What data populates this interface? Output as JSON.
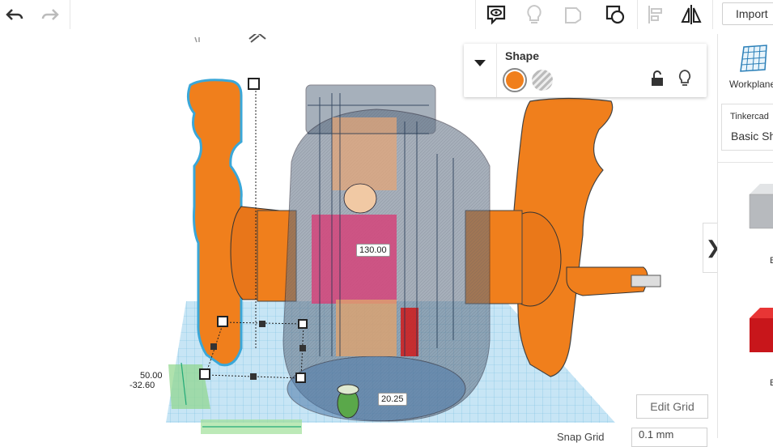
{
  "toolbar": {
    "undo_icon": "undo-arrow-icon",
    "redo_icon": "redo-arrow-icon",
    "notes_icon": "speech-bubble-eye-icon",
    "light_icon": "lightbulb-icon",
    "shape_icon": "note-shape-icon",
    "group_icon": "group-shapes-icon",
    "align_icon": "align-icon",
    "mirror_icon": "mirror-icon",
    "import_label": "Import"
  },
  "shape_panel": {
    "title": "Shape",
    "solid_color": "#f07f1c",
    "hole_label_icon": "hole-striped-icon",
    "lock_icon": "unlock-icon",
    "hide_icon": "lightbulb-icon"
  },
  "viewport": {
    "dimension_height": "130.00",
    "dimension_width": "20.25",
    "dimension_left": "50.00",
    "dimension_left2": "-32.60",
    "edit_grid_label": "Edit Grid",
    "snap_grid_label": "Snap Grid",
    "snap_grid_value": "0.1 mm"
  },
  "right_panel": {
    "workplane_label": "Workplane",
    "library_source": "Tinkercad",
    "library_name": "Basic Shapes",
    "item1_label": "B",
    "item2_label": "B"
  },
  "colors": {
    "accent": "#f07f1c",
    "selection": "#3aa7d8",
    "grid": "#59b7e2"
  }
}
